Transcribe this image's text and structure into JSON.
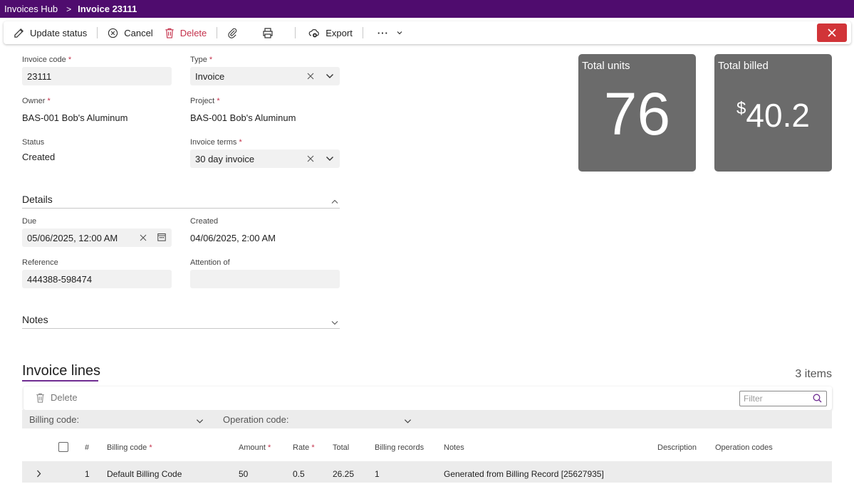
{
  "breadcrumb": {
    "root": "Invoices Hub",
    "separator": ">",
    "current": "Invoice 23111"
  },
  "toolbar": {
    "update_status": "Update status",
    "cancel": "Cancel",
    "delete": "Delete",
    "export": "Export",
    "more": "···"
  },
  "fields": {
    "invoice_code": {
      "label": "Invoice code",
      "value": "23111"
    },
    "type": {
      "label": "Type",
      "value": "Invoice"
    },
    "owner": {
      "label": "Owner",
      "value": "BAS-001 Bob's Aluminum"
    },
    "project": {
      "label": "Project",
      "value": "BAS-001 Bob's Aluminum"
    },
    "status": {
      "label": "Status",
      "value": "Created"
    },
    "invoice_terms": {
      "label": "Invoice terms",
      "value": "30 day invoice"
    }
  },
  "details": {
    "title": "Details",
    "due": {
      "label": "Due",
      "value": "05/06/2025, 12:00 AM"
    },
    "created": {
      "label": "Created",
      "value": "04/06/2025, 2:00 AM"
    },
    "reference": {
      "label": "Reference",
      "value": "444388-598474"
    },
    "attention": {
      "label": "Attention of",
      "value": ""
    }
  },
  "notes": {
    "title": "Notes"
  },
  "tiles": {
    "units": {
      "title": "Total units",
      "value": "76"
    },
    "billed": {
      "title": "Total billed",
      "currency": "$",
      "value": "40.2"
    }
  },
  "lines": {
    "title": "Invoice lines",
    "count": "3 items",
    "delete": "Delete",
    "filter_placeholder": "Filter",
    "billing_filter": "Billing code:",
    "operation_filter": "Operation code:",
    "columns": [
      "#",
      "Billing code",
      "Amount",
      "Rate",
      "Total",
      "Billing records",
      "Notes",
      "Description",
      "Operation codes"
    ],
    "rows": [
      {
        "num": "1",
        "billing_code": "Default Billing Code",
        "amount": "50",
        "rate": "0.5",
        "total": "26.25",
        "records": "1",
        "notes": "Generated from Billing Record [25627935]",
        "description": "",
        "operation_codes": ""
      }
    ]
  },
  "colors": {
    "brand": "#4f0c6e",
    "danger": "#d13438",
    "tile": "#6b6b6b",
    "accent_underline": "#6f2c91"
  }
}
